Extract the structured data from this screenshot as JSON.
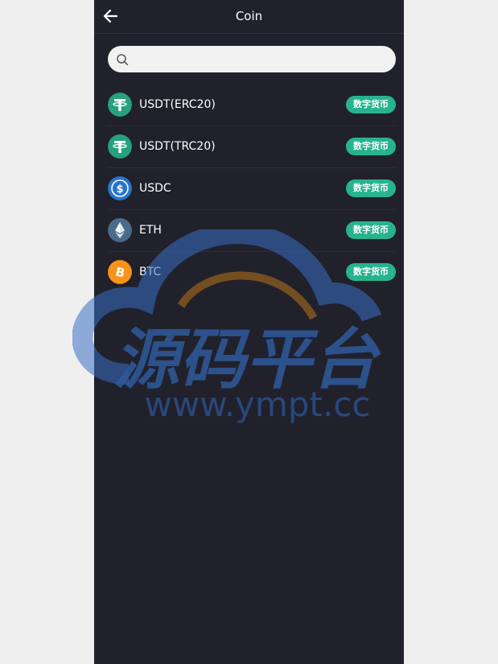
{
  "header": {
    "title": "Coin",
    "back_icon": "arrow-left-icon"
  },
  "search": {
    "placeholder": "",
    "value": "",
    "icon": "search-icon"
  },
  "coins": [
    {
      "name": "USDT(ERC20)",
      "tag": "数字货币",
      "icon": "tether-icon",
      "color": "#26a17b"
    },
    {
      "name": "USDT(TRC20)",
      "tag": "数字货币",
      "icon": "tether-icon",
      "color": "#26a17b"
    },
    {
      "name": "USDC",
      "tag": "数字货币",
      "icon": "usdc-icon",
      "color": "#2775ca"
    },
    {
      "name": "ETH",
      "tag": "数字货币",
      "icon": "ethereum-icon",
      "color": "#4a6b8a"
    },
    {
      "name": "BTC",
      "tag": "数字货币",
      "icon": "bitcoin-icon",
      "color": "#f7931a"
    }
  ],
  "watermark": {
    "main": "源码平台",
    "url": "www.ympt.cc"
  },
  "colors": {
    "background": "#21212c",
    "tag": "#26b48e"
  }
}
